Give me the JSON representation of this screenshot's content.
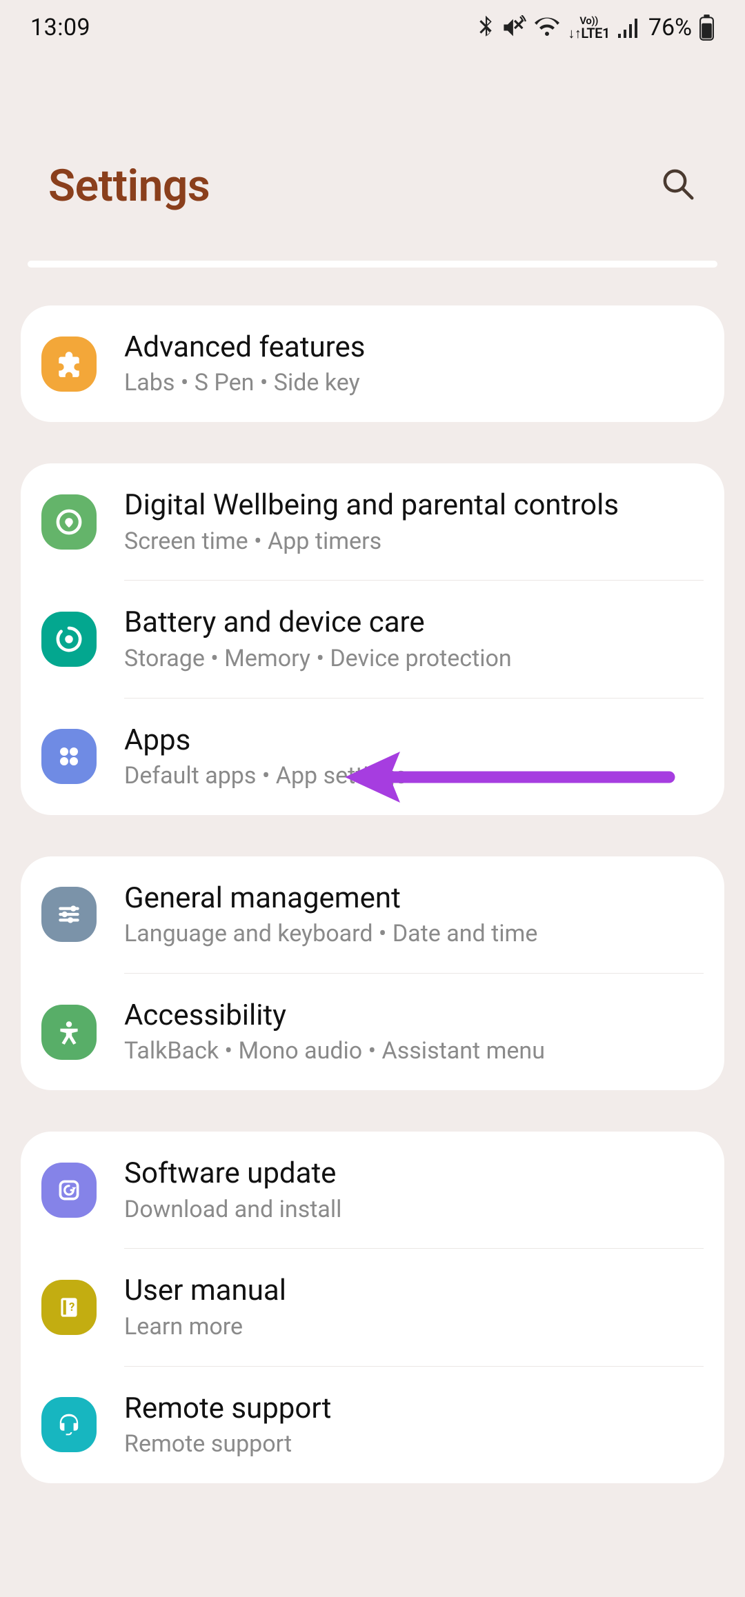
{
  "status": {
    "time": "13:09",
    "battery": "76%"
  },
  "header": {
    "title": "Settings"
  },
  "groups": [
    {
      "items": [
        {
          "icon": "puzzle-icon",
          "color": "ic-orange",
          "title": "Advanced features",
          "sub": "Labs  •  S Pen  •  Side key"
        }
      ]
    },
    {
      "items": [
        {
          "icon": "wellbeing-icon",
          "color": "ic-green1",
          "title": "Digital Wellbeing and parental controls",
          "sub": "Screen time  •  App timers"
        },
        {
          "icon": "battery-icon",
          "color": "ic-teal",
          "title": "Battery and device care",
          "sub": "Storage  •  Memory  •  Device protection"
        },
        {
          "icon": "apps-icon",
          "color": "ic-blue",
          "title": "Apps",
          "sub": "Default apps  •  App settings"
        }
      ]
    },
    {
      "items": [
        {
          "icon": "sliders-icon",
          "color": "ic-slate",
          "title": "General management",
          "sub": "Language and keyboard  •  Date and time"
        },
        {
          "icon": "accessibility-icon",
          "color": "ic-green2",
          "title": "Accessibility",
          "sub": "TalkBack  •  Mono audio  •  Assistant menu"
        }
      ]
    },
    {
      "items": [
        {
          "icon": "update-icon",
          "color": "ic-purple",
          "title": "Software update",
          "sub": "Download and install"
        },
        {
          "icon": "manual-icon",
          "color": "ic-olive",
          "title": "User manual",
          "sub": "Learn more"
        },
        {
          "icon": "support-icon",
          "color": "ic-cyan",
          "title": "Remote support",
          "sub": "Remote support"
        }
      ]
    }
  ]
}
